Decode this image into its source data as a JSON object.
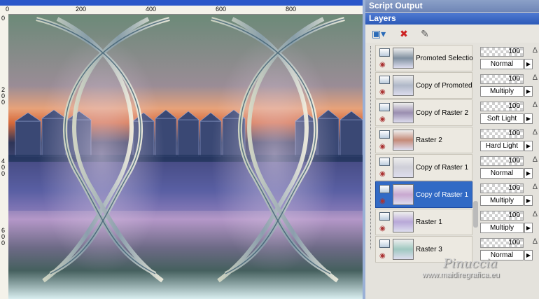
{
  "rulers": {
    "horizontal_ticks": [
      "0",
      "200",
      "400",
      "600",
      "800"
    ],
    "vertical_ticks": [
      "0",
      "2\n0\n0",
      "4\n0\n0",
      "6\n0\n0"
    ]
  },
  "panels": {
    "script_output_title": "Script Output",
    "layers_title": "Layers"
  },
  "layers": [
    {
      "name": "Promoted Selection",
      "opacity": "100",
      "blend": "Normal",
      "selected": false,
      "thumb": "#8090a0"
    },
    {
      "name": "Copy of Promoted",
      "opacity": "100",
      "blend": "Multiply",
      "selected": false,
      "thumb": "#b0b8c8"
    },
    {
      "name": "Copy of Raster 2",
      "opacity": "100",
      "blend": "Soft Light",
      "selected": false,
      "thumb": "#9a8db0"
    },
    {
      "name": "Raster 2",
      "opacity": "100",
      "blend": "Hard Light",
      "selected": false,
      "thumb": "#c58a78"
    },
    {
      "name": "Copy of Raster 1",
      "opacity": "100",
      "blend": "Normal",
      "selected": false,
      "thumb": "#cfcfd8"
    },
    {
      "name": "Copy of Raster 1",
      "opacity": "100",
      "blend": "Multiply",
      "selected": true,
      "thumb": "#c8a8d0"
    },
    {
      "name": "Raster 1",
      "opacity": "100",
      "blend": "Multiply",
      "selected": false,
      "thumb": "#b8a8d8"
    },
    {
      "name": "Raster 3",
      "opacity": "100",
      "blend": "Normal",
      "selected": false,
      "thumb": "#9fc8c0"
    }
  ],
  "watermark": {
    "signature": "Pinuccia",
    "url": "www.maidiregrafica.eu"
  },
  "colors": {
    "selected_row": "#316ac5",
    "title_bar": "#2c5ab8"
  }
}
